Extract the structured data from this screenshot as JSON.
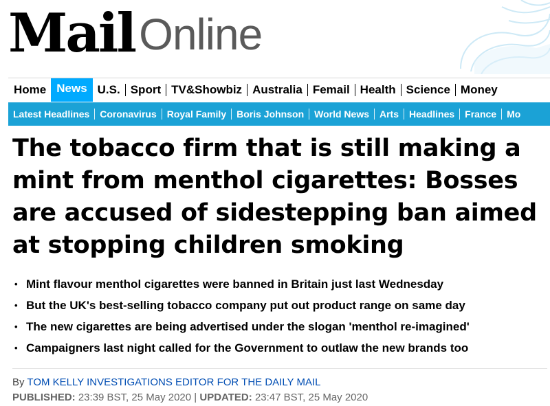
{
  "brand": {
    "mail": "Mail",
    "online": "Online"
  },
  "nav": {
    "items": [
      "Home",
      "News",
      "U.S.",
      "Sport",
      "TV&Showbiz",
      "Australia",
      "Femail",
      "Health",
      "Science",
      "Money"
    ],
    "active": "News"
  },
  "subnav": {
    "items": [
      "Latest Headlines",
      "Coronavirus",
      "Royal Family",
      "Boris Johnson",
      "World News",
      "Arts",
      "Headlines",
      "France",
      "Mo"
    ]
  },
  "article": {
    "headline": "The tobacco firm that is still making a mint from menthol cigarettes: Bosses are accused of sidestepping ban aimed at stopping children smoking",
    "bullets": [
      "Mint flavour menthol cigarettes were banned in Britain just last Wednesday",
      "But the UK's best-selling tobacco company put out product range on same day",
      "The new cigarettes are being advertised under the slogan 'menthol re-imagined'",
      "Campaigners last night called for the Government to outlaw the new brands too"
    ],
    "bullet_glyph": "•",
    "byline_prefix": "By",
    "author": "TOM KELLY INVESTIGATIONS EDITOR FOR THE DAILY MAIL",
    "published_label": "PUBLISHED:",
    "published": "23:39 BST, 25 May 2020",
    "date_sep": "|",
    "updated_label": "UPDATED:",
    "updated": "23:47 BST, 25 May 2020"
  },
  "colors": {
    "nav_active": "#00aaff",
    "subnav_bg": "#1ba2d6",
    "author_link": "#004db3"
  }
}
